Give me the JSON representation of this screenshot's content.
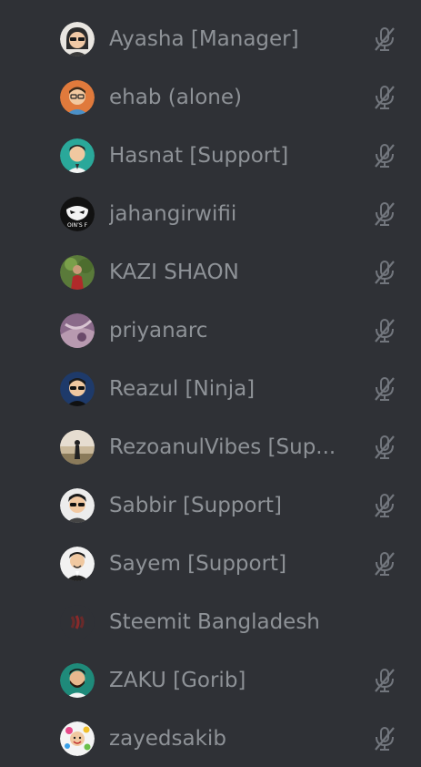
{
  "members": [
    {
      "name": "Ayasha [Manager]",
      "avatar_bg": "#e9e6e1",
      "avatar": "avatar-woman-glasses",
      "muted": true
    },
    {
      "name": "ehab (alone)",
      "avatar_bg": "#e07a3c",
      "avatar": "avatar-man-orange",
      "muted": true
    },
    {
      "name": "Hasnat [Support]",
      "avatar_bg": "#2aa89a",
      "avatar": "avatar-man-teal",
      "muted": true
    },
    {
      "name": "jahangirwifii",
      "avatar_bg": "#111111",
      "avatar": "avatar-mask",
      "muted": true
    },
    {
      "name": "KAZI SHAON",
      "avatar_bg": "#5a7a3a",
      "avatar": "avatar-photo-outdoor",
      "muted": true
    },
    {
      "name": "priyanarc",
      "avatar_bg": "#8a6a8a",
      "avatar": "avatar-photo-purple",
      "muted": true
    },
    {
      "name": "Reazul [Ninja]",
      "avatar_bg": "#1e3a6a",
      "avatar": "avatar-man-sunglasses-navy",
      "muted": true
    },
    {
      "name": "RezoanulVibes [Sup...",
      "avatar_bg": "#c9b89a",
      "avatar": "avatar-photo-field",
      "muted": true
    },
    {
      "name": "Sabbir [Support]",
      "avatar_bg": "#ececec",
      "avatar": "avatar-man-sunglasses",
      "muted": true
    },
    {
      "name": "Sayem [Support]",
      "avatar_bg": "#f2f2f2",
      "avatar": "avatar-man-suit",
      "muted": true
    },
    {
      "name": "Steemit Bangladesh",
      "avatar_bg": "#2f3136",
      "avatar": "avatar-steemit-logo",
      "muted": false
    },
    {
      "name": "ZAKU [Gorib]",
      "avatar_bg": "#1f8a7a",
      "avatar": "avatar-man-beard",
      "muted": true
    },
    {
      "name": "zayedsakib",
      "avatar_bg": "#f4f4f4",
      "avatar": "avatar-cartoon-colorful",
      "muted": true
    }
  ],
  "icon": "muted-mic-icon",
  "colors": {
    "background": "#2f3136",
    "text": "#8e9297",
    "icon": "#72767d"
  }
}
